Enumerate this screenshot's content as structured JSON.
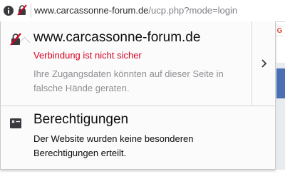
{
  "urlbar": {
    "url_host": "www.carcassonne-forum.de",
    "url_path": "/ucp.php?mode=login"
  },
  "extension": {
    "badge": "G"
  },
  "panel": {
    "connection": {
      "host": "www.carcassonne-forum.de",
      "warning": "Verbindung ist nicht sicher",
      "description": "Ihre Zugangsdaten könnten auf dieser Seite in falsche Hände geraten."
    },
    "permissions": {
      "title": "Berechtigungen",
      "description": "Der Website wurden keine besonderen Berechtigungen erteilt."
    }
  },
  "colors": {
    "warning": "#d70022",
    "muted": "#8f8f94",
    "text": "#0c0c0d"
  },
  "icons": {
    "info": "info-icon",
    "insecure_lock": "insecure-lock-icon",
    "chevron": "chevron-right-icon",
    "permissions": "permissions-icon"
  }
}
